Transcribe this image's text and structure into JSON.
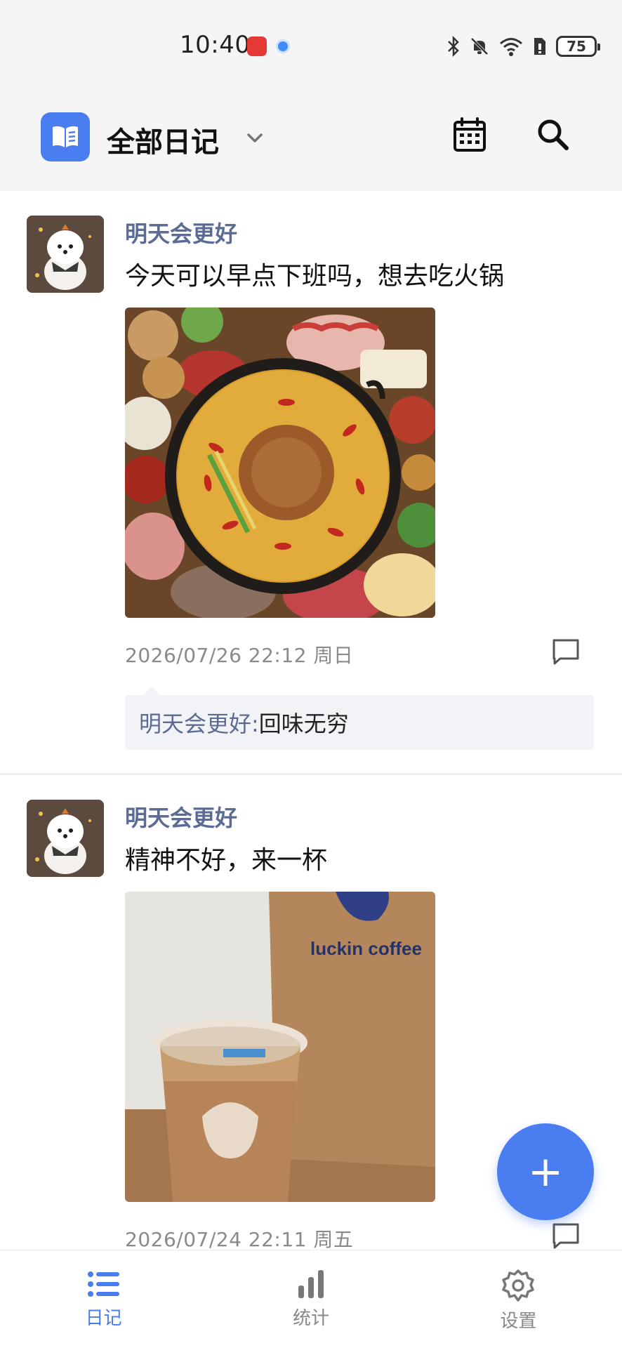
{
  "status_bar": {
    "time": "10:40",
    "battery": "75",
    "icons": [
      "huawei-app-icon",
      "browser-icon",
      "bluetooth-icon",
      "bell-off-icon",
      "wifi-icon",
      "sim-icon",
      "battery-icon"
    ]
  },
  "header": {
    "title": "全部日记",
    "icons": [
      "diary-book-icon",
      "chevron-down-icon",
      "calendar-icon",
      "search-icon"
    ]
  },
  "posts": [
    {
      "author": "明天会更好",
      "content": "今天可以早点下班吗，想去吃火锅",
      "image": "hotpot-photo",
      "timestamp": "2026/07/26 22:12 周日",
      "comment": {
        "author": "明天会更好:",
        "text": " 回味无穷"
      }
    },
    {
      "author": "明天会更好",
      "content": "精神不好，来一杯",
      "image": "luckin-coffee-photo",
      "photo_brand_text": "luckin coffee",
      "timestamp": "2026/07/24 22:11 周五"
    }
  ],
  "fab": {
    "label": "+"
  },
  "bottom_nav": [
    {
      "label": "日记",
      "icon": "list-icon",
      "active": true
    },
    {
      "label": "统计",
      "icon": "bar-chart-icon",
      "active": false
    },
    {
      "label": "设置",
      "icon": "gear-icon",
      "active": false
    }
  ],
  "colors": {
    "accent": "#4a7df0",
    "author": "#5b6b94",
    "meta": "#8a8a8a",
    "header_bg": "#f5f5f5"
  }
}
